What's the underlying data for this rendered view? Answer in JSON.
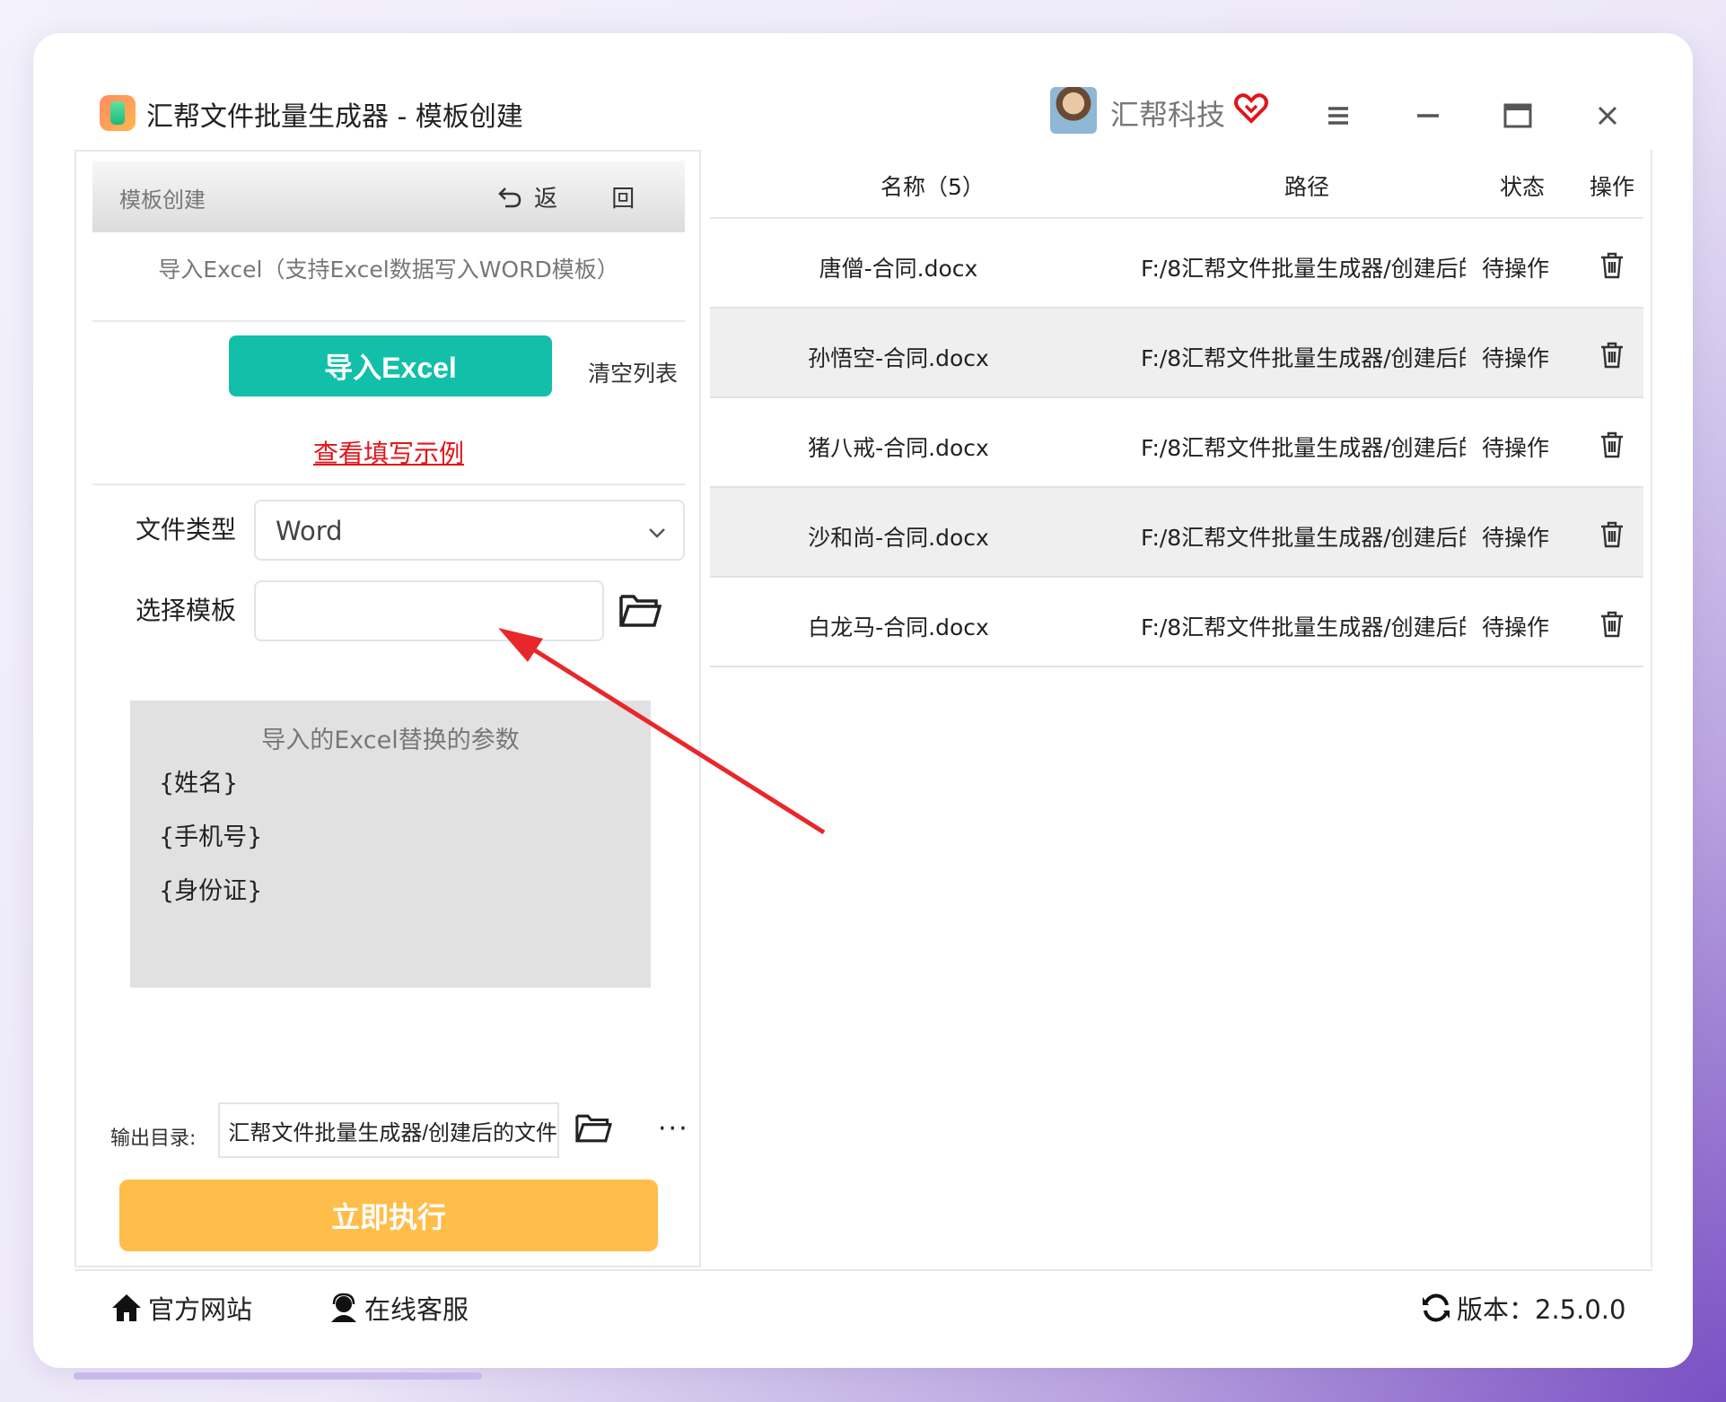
{
  "app": {
    "title": "汇帮文件批量生成器 - 模板创建",
    "brand": "汇帮科技"
  },
  "left": {
    "header_title": "模板创建",
    "back_label": "返 回",
    "import_hint": "导入Excel（支持Excel数据写入WORD模板）",
    "import_button": "导入Excel",
    "clear_list": "清空列表",
    "example_link": "查看填写示例",
    "file_type_label": "文件类型",
    "file_type_value": "Word",
    "template_label": "选择模板",
    "template_value": "",
    "params_title": "导入的Excel替换的参数",
    "params": [
      "{姓名}",
      "{手机号}",
      "{身份证}"
    ],
    "output_label": "输出目录:",
    "output_value": "汇帮文件批量生成器/创建后的文件",
    "more": "···",
    "run_button": "立即执行"
  },
  "table": {
    "headers": [
      "名称（5）",
      "路径",
      "状态",
      "操作"
    ],
    "rows": [
      {
        "name": "唐僧-合同.docx",
        "path": "F:/8汇帮文件批量生成器/创建后的",
        "status": "待操作"
      },
      {
        "name": "孙悟空-合同.docx",
        "path": "F:/8汇帮文件批量生成器/创建后的",
        "status": "待操作"
      },
      {
        "name": "猪八戒-合同.docx",
        "path": "F:/8汇帮文件批量生成器/创建后的",
        "status": "待操作"
      },
      {
        "name": "沙和尚-合同.docx",
        "path": "F:/8汇帮文件批量生成器/创建后的",
        "status": "待操作"
      },
      {
        "name": "白龙马-合同.docx",
        "path": "F:/8汇帮文件批量生成器/创建后的",
        "status": "待操作"
      }
    ]
  },
  "footer": {
    "website": "官方网站",
    "support": "在线客服",
    "version": "版本：2.5.0.0"
  },
  "colors": {
    "accent_teal": "#12bfa9",
    "accent_orange": "#ffbd4a",
    "link_red": "#e0161b",
    "annotation_arrow": "#e8272a"
  }
}
